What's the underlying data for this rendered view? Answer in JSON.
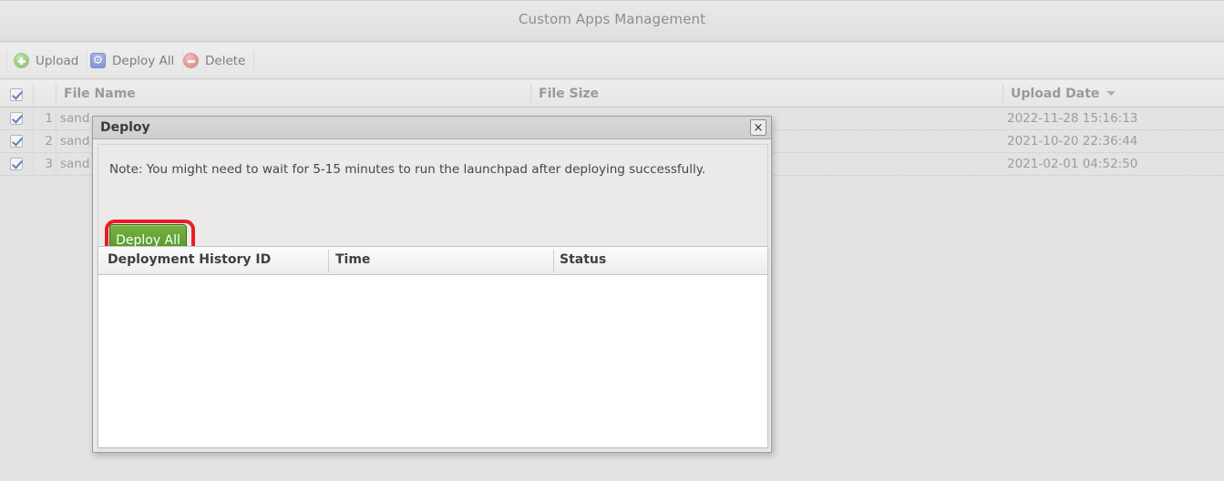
{
  "window": {
    "title": "Custom Apps Management"
  },
  "toolbar": {
    "buttons": [
      {
        "label": "Upload",
        "icon": "plus-circle-icon"
      },
      {
        "label": "Deploy All",
        "icon": "gear-icon"
      },
      {
        "label": "Delete",
        "icon": "minus-circle-icon"
      }
    ]
  },
  "grid": {
    "columns": [
      {
        "label": "File Name"
      },
      {
        "label": "File Size"
      },
      {
        "label": "Upload Date",
        "sort": "desc",
        "sort_glyph": "sort-descending-icon"
      }
    ],
    "header_checkbox_checked": true,
    "rows": [
      {
        "num": "1",
        "checked": true,
        "file_name": "sand",
        "file_size": "",
        "upload_date": "2022-11-28 15:16:13"
      },
      {
        "num": "2",
        "checked": true,
        "file_name": "sand",
        "file_size": "",
        "upload_date": "2021-10-20 22:36:44"
      },
      {
        "num": "3",
        "checked": true,
        "file_name": "sand",
        "file_size": "",
        "upload_date": "2021-02-01 04:52:50"
      }
    ]
  },
  "dialog": {
    "title": "Deploy",
    "close_label": "×",
    "note": "Note: You might need to wait for 5-15 minutes to run the launchpad after deploying successfully.",
    "deploy_all_label": "Deploy All",
    "highlight_color": "#ee1c22",
    "button_color": "#63a233",
    "history": {
      "columns": [
        {
          "label": "Deployment History ID"
        },
        {
          "label": "Time"
        },
        {
          "label": "Status"
        }
      ],
      "rows": []
    }
  }
}
